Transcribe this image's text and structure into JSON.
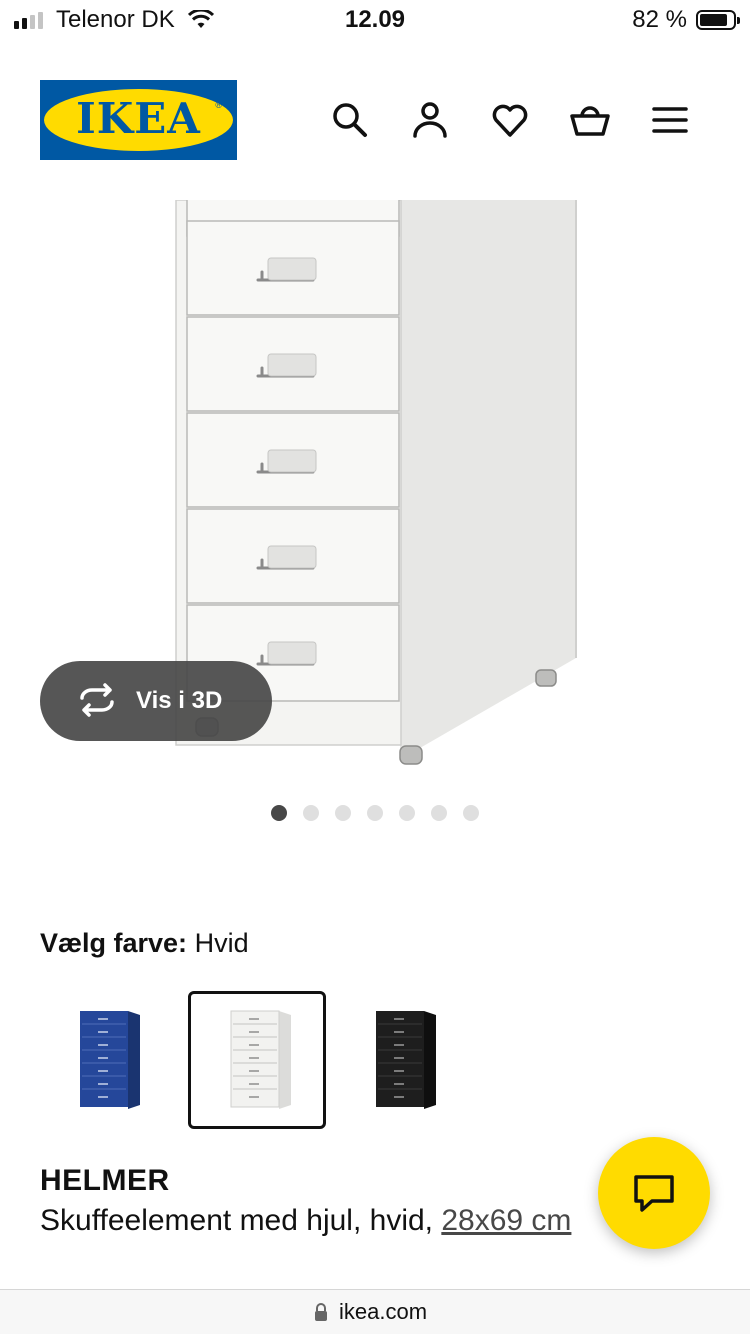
{
  "status_bar": {
    "carrier": "Telenor DK",
    "time": "12.09",
    "battery_percent": "82 %",
    "battery_level": 0.82,
    "signal_bars_filled": 2,
    "signal_bars_total": 4
  },
  "header": {
    "logo_text": "IKEA",
    "logo_mark": "®",
    "icons": [
      "search-icon",
      "profile-icon",
      "heart-icon",
      "basket-icon",
      "menu-icon"
    ]
  },
  "gallery": {
    "view_3d_label": "Vis i 3D",
    "image_count": 7,
    "active_index": 0
  },
  "color_picker": {
    "label": "Vælg farve:",
    "selected": "Hvid",
    "options": [
      {
        "name": "blue",
        "color": "#21428f"
      },
      {
        "name": "white",
        "color": "#f2f2f0"
      },
      {
        "name": "black",
        "color": "#1c1c1c"
      }
    ]
  },
  "product": {
    "name": "HELMER",
    "description": "Skuffeelement med hjul, hvid, ",
    "size_link": "28x69 cm"
  },
  "browser": {
    "url": "ikea.com"
  },
  "colors": {
    "ikea_blue": "#0058a3",
    "ikea_yellow": "#ffdb00"
  }
}
